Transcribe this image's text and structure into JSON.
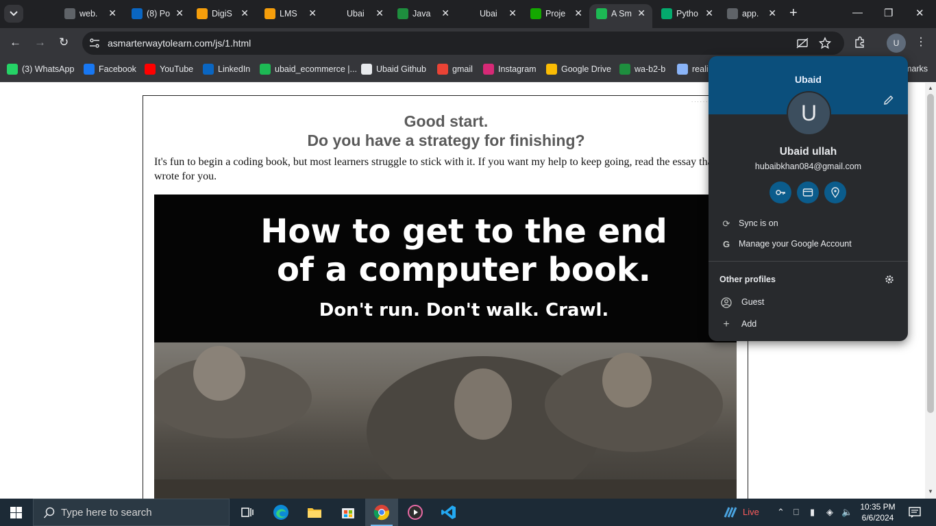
{
  "browser": {
    "tabs": [
      {
        "title": "",
        "favicon": "chatgpt-icon",
        "color": "#202124"
      },
      {
        "title": "web.",
        "favicon": "whatsapp-icon",
        "color": "#5f6368"
      },
      {
        "title": "(8) Po",
        "favicon": "linkedin-icon",
        "color": "#0a66c2"
      },
      {
        "title": "DigiS",
        "favicon": "digiskills-icon",
        "color": "#f59e0b"
      },
      {
        "title": "LMS",
        "favicon": "digiskills-icon",
        "color": "#f59e0b"
      },
      {
        "title": "Ubai",
        "favicon": "github-icon",
        "color": "#202124"
      },
      {
        "title": "Java",
        "favicon": "google-classroom-icon",
        "color": "#1e8e3e"
      },
      {
        "title": "Ubai",
        "favicon": "github-icon",
        "color": "#202124"
      },
      {
        "title": "Proje",
        "favicon": "upwork-icon",
        "color": "#14a800"
      },
      {
        "title": "A Sm",
        "favicon": "asmarterway-icon",
        "color": "#1db954",
        "active": true
      },
      {
        "title": "Pytho",
        "favicon": "w3schools-icon",
        "color": "#04aa6d"
      },
      {
        "title": "app.",
        "favicon": "globe-icon",
        "color": "#5f6368"
      }
    ],
    "url": "asmarterwaytolearn.com/js/1.html",
    "avatar_letter": "U"
  },
  "bookmarks": [
    {
      "label": "(3) WhatsApp",
      "icon": "whatsapp-icon",
      "color": "#25d366"
    },
    {
      "label": "Facebook",
      "icon": "facebook-icon",
      "color": "#1877f2"
    },
    {
      "label": "YouTube",
      "icon": "youtube-icon",
      "color": "#ff0000"
    },
    {
      "label": "LinkedIn",
      "icon": "linkedin-icon",
      "color": "#0a66c2"
    },
    {
      "label": "ubaid_ecommerce |...",
      "icon": "shopify-icon",
      "color": "#1db954"
    },
    {
      "label": "Ubaid Github",
      "icon": "github-icon",
      "color": "#e8eaed"
    },
    {
      "label": "gmail",
      "icon": "gmail-icon",
      "color": "#ea4335"
    },
    {
      "label": "Instagram",
      "icon": "instagram-icon",
      "color": "#d62976"
    },
    {
      "label": "Google Drive",
      "icon": "google-drive-icon",
      "color": "#fbbc04"
    },
    {
      "label": "wa-b2-b",
      "icon": "google-classroom-icon",
      "color": "#1e8e3e"
    },
    {
      "label": "reali",
      "icon": "search-icon",
      "color": "#8ab4f8"
    },
    {
      "label": "marks",
      "icon": "",
      "color": ""
    }
  ],
  "page": {
    "heading1": "Good start.",
    "heading2": "Do you have a strategy for finishing?",
    "intro": "It's fun to begin a coding book, but most learners struggle to stick with it. If you want my help to keep going, read the essay that I wrote for you.",
    "banner_line1": "How to get to the end",
    "banner_line2": "of a computer book.",
    "banner_line3": "Don't run. Don't walk. Crawl."
  },
  "profile_menu": {
    "header_name": "Ubaid",
    "avatar_letter": "U",
    "full_name": "Ubaid ullah",
    "email": "hubaibkhan084@gmail.com",
    "sync_label": "Sync is on",
    "manage_label": "Manage your Google Account",
    "other_profiles_label": "Other profiles",
    "guest_label": "Guest",
    "add_label": "Add",
    "header_color": "#0b4f7c"
  },
  "taskbar": {
    "search_placeholder": "Type here to search",
    "live_label": "Live",
    "time": "10:35 PM",
    "date": "6/6/2024"
  }
}
